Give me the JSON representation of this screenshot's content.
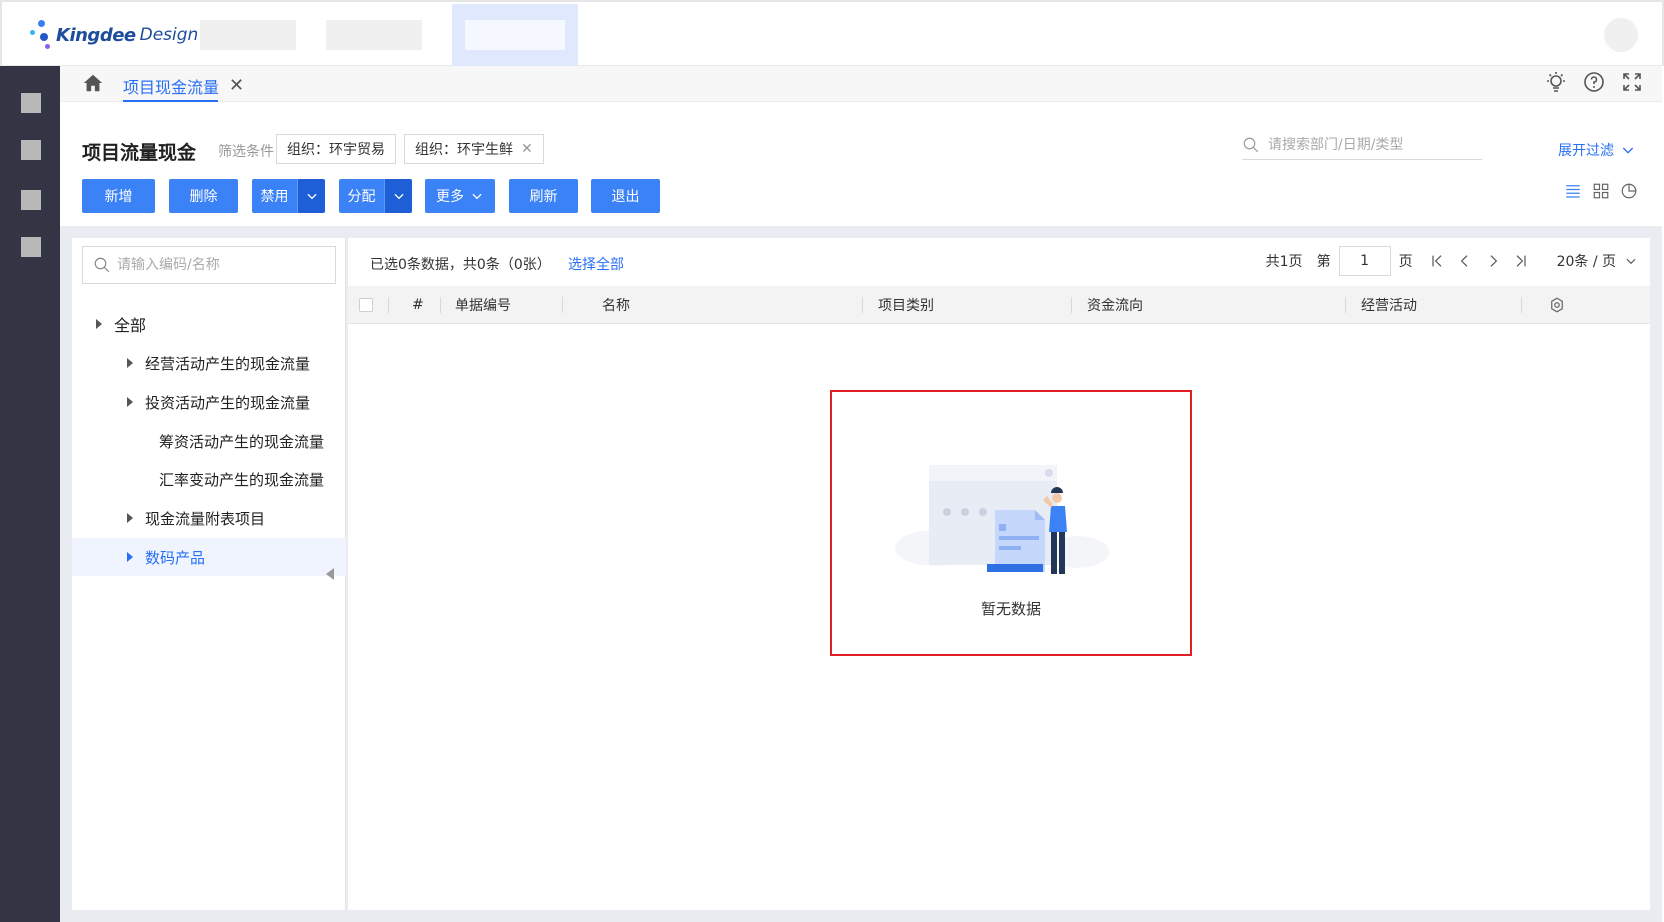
{
  "brand": {
    "name": "Kingdee",
    "suffix": "Design"
  },
  "tabs": [
    {
      "label": "项目现金流量"
    }
  ],
  "page": {
    "title": "项目流量现金",
    "filter_label": "筛选条件",
    "chips": [
      "组织：环宇贸易",
      "组织：环宇生鲜"
    ],
    "search_placeholder": "请搜索部门/日期/类型",
    "expand_filter": "展开过滤"
  },
  "toolbar": {
    "add": "新增",
    "delete": "删除",
    "disable": "禁用",
    "assign": "分配",
    "more": "更多",
    "refresh": "刷新",
    "exit": "退出"
  },
  "tree": {
    "search_placeholder": "请输入编码/名称",
    "items": [
      {
        "label": "全部"
      },
      {
        "label": "经营活动产生的现金流量"
      },
      {
        "label": "投资活动产生的现金流量"
      },
      {
        "label": "筹资活动产生的现金流量"
      },
      {
        "label": "汇率变动产生的现金流量"
      },
      {
        "label": "现金流量附表项目"
      },
      {
        "label": "数码产品"
      }
    ]
  },
  "table": {
    "selection_info": "已选0条数据，共0条（0张）",
    "select_all": "选择全部",
    "pager": {
      "total_pages": "共1页",
      "page_prefix": "第",
      "page": "1",
      "page_suffix": "页",
      "page_size": "20条 / 页"
    },
    "columns": [
      "#",
      "单据编号",
      "名称",
      "项目类别",
      "资金流向",
      "经营活动"
    ],
    "empty_text": "暂无数据"
  },
  "colors": {
    "primary": "#3b82f6",
    "primary_dark": "#1e5ed6",
    "link": "#276ff5",
    "sidebar": "#333545",
    "highlight_border": "#e31f26"
  }
}
